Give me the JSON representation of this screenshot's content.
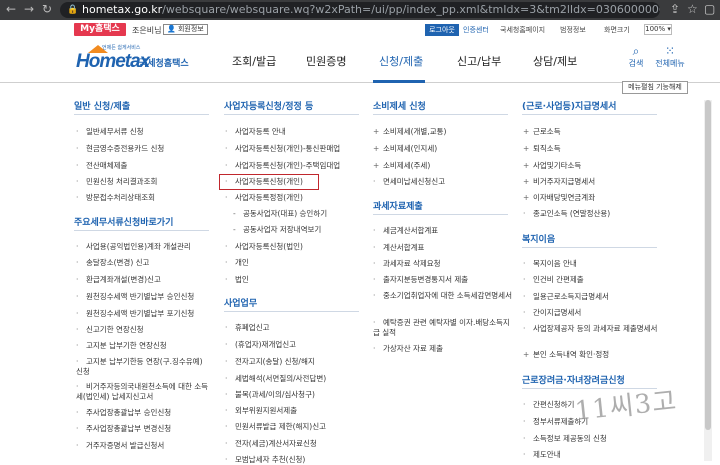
{
  "browser": {
    "url_host": "hometax.go.kr",
    "url_path": "/websquare/websquare.wq?w2xPath=/ui/pp/index_pp.xml&tmIdx=3&tm2lIdx=0306000000&tm3lIdx=0306020000"
  },
  "topbar": {
    "my_hometax": "My홈택스",
    "user_name": "조은비님",
    "member_info": "회원정보",
    "logout": "로그아웃",
    "cert_center": "인증센터",
    "site_intro": "국세청홈페이지",
    "sitemap": "범정정보",
    "screen_size": "화면크기",
    "zoom": "100%"
  },
  "logo": {
    "tagline": "언제든 쉽게서비스",
    "main": "Hometax",
    "sub": "국세청홈택스"
  },
  "gnb": [
    "조회/발급",
    "민원증명",
    "신청/제출",
    "신고/납부",
    "상담/제보"
  ],
  "gnb_active": "신청/제출",
  "util": {
    "search": "검색",
    "all_menu": "전체메뉴"
  },
  "func_button": "메뉴펼침 기능해제",
  "columns": [
    {
      "sections": [
        {
          "title": "일반 신청/제출",
          "items": [
            "일반세무서류 신청",
            "현금영수증전용카드 신청",
            "전산매체제출",
            "민원신청 처리결과조회",
            "방문접수처리상태조회"
          ]
        },
        {
          "title": "주요세무서류신청바로가기",
          "items": [
            "사업용(공익법인용)계좌 개설관리",
            "송달장소(변경) 신고",
            "환급계좌개설(변경)신고",
            "원천징수세액 반기별납부 승인신청",
            "원천징수세액 반기별납부 포기신청",
            "신고기한 연장신청",
            "고지분 납부기한 연장신청",
            "고지분 납부기한등 연장(구.징수유예) 신청",
            "비거주자등의국내원천소득에 대한 소득세(법인세) 납세지신고서",
            "주사업장총괄납부 승인신청",
            "주사업장총괄납부 변경신청",
            "거주자증명서 발급신청서"
          ]
        }
      ]
    },
    {
      "sections": [
        {
          "title": "사업자등록신청/정정 등",
          "items": [
            "사업자등록 안내",
            "사업자등록신청(개인)-통신판매업",
            "사업자등록신청(개인)-주택임대업",
            "사업자등록신청(개인)",
            "사업자등록정정(개인)",
            "공동사업자(대표) 승인하기",
            "공동사업자 저장내역보기",
            "사업자등록신청(법인)",
            "개인",
            "법인"
          ]
        },
        {
          "title": "사업업무",
          "items": [
            "휴폐업신고",
            "(휴업자)재개업신고",
            "전자고지(송달) 신청/해지",
            "세법해석(서면질의/사전답변)",
            "불복(과세/이의/심사청구)",
            "외부위원지원서제출",
            "민원서류발급 제한(해지)신고",
            "전자(세금)계산서자료신청",
            "모범납세자 추천(신청)"
          ]
        }
      ]
    },
    {
      "sections": [
        {
          "title": "소비제세 신청",
          "items": [
            "소비제세(개별,교통)",
            "소비제세(인지세)",
            "소비제세(주세)",
            "면세미납세신청신고"
          ]
        },
        {
          "title": "과세자료제출",
          "items": [
            "세금계산서합계표",
            "계산서합계표",
            "과세자료 삭제요청",
            "출자지분등변경통지서 제출",
            "중소기업취업자에 대한 소득세감면명세서",
            "예탁증권 관련 예탁자별 이자.배당소득지급 실적",
            "가상자산 자료 제출"
          ]
        }
      ]
    },
    {
      "sections": [
        {
          "title": "(근로·사업등)지급명세서",
          "items": [
            "근로소득",
            "퇴직소득",
            "사업및기타소득",
            "비거주자지급명세서",
            "이자배당및연금계좌",
            "종교인소득 (연말정산용)"
          ]
        },
        {
          "title": "복지이음",
          "items": [
            "복지이음 안내",
            "인건비 간편제출",
            "일용근로소득지급명세서",
            "간이지급명세서",
            "사업장제공자 등의 과세자료 제출명세서",
            "본인 소득내역 확인·정정"
          ]
        },
        {
          "title": "근로장려금·자녀장려금신청",
          "items": [
            "간편신청하기",
            "정부서류제출하기",
            "소득정보 제공동의 신청",
            "제도안내"
          ]
        }
      ]
    }
  ],
  "watermark": "11씨3고"
}
